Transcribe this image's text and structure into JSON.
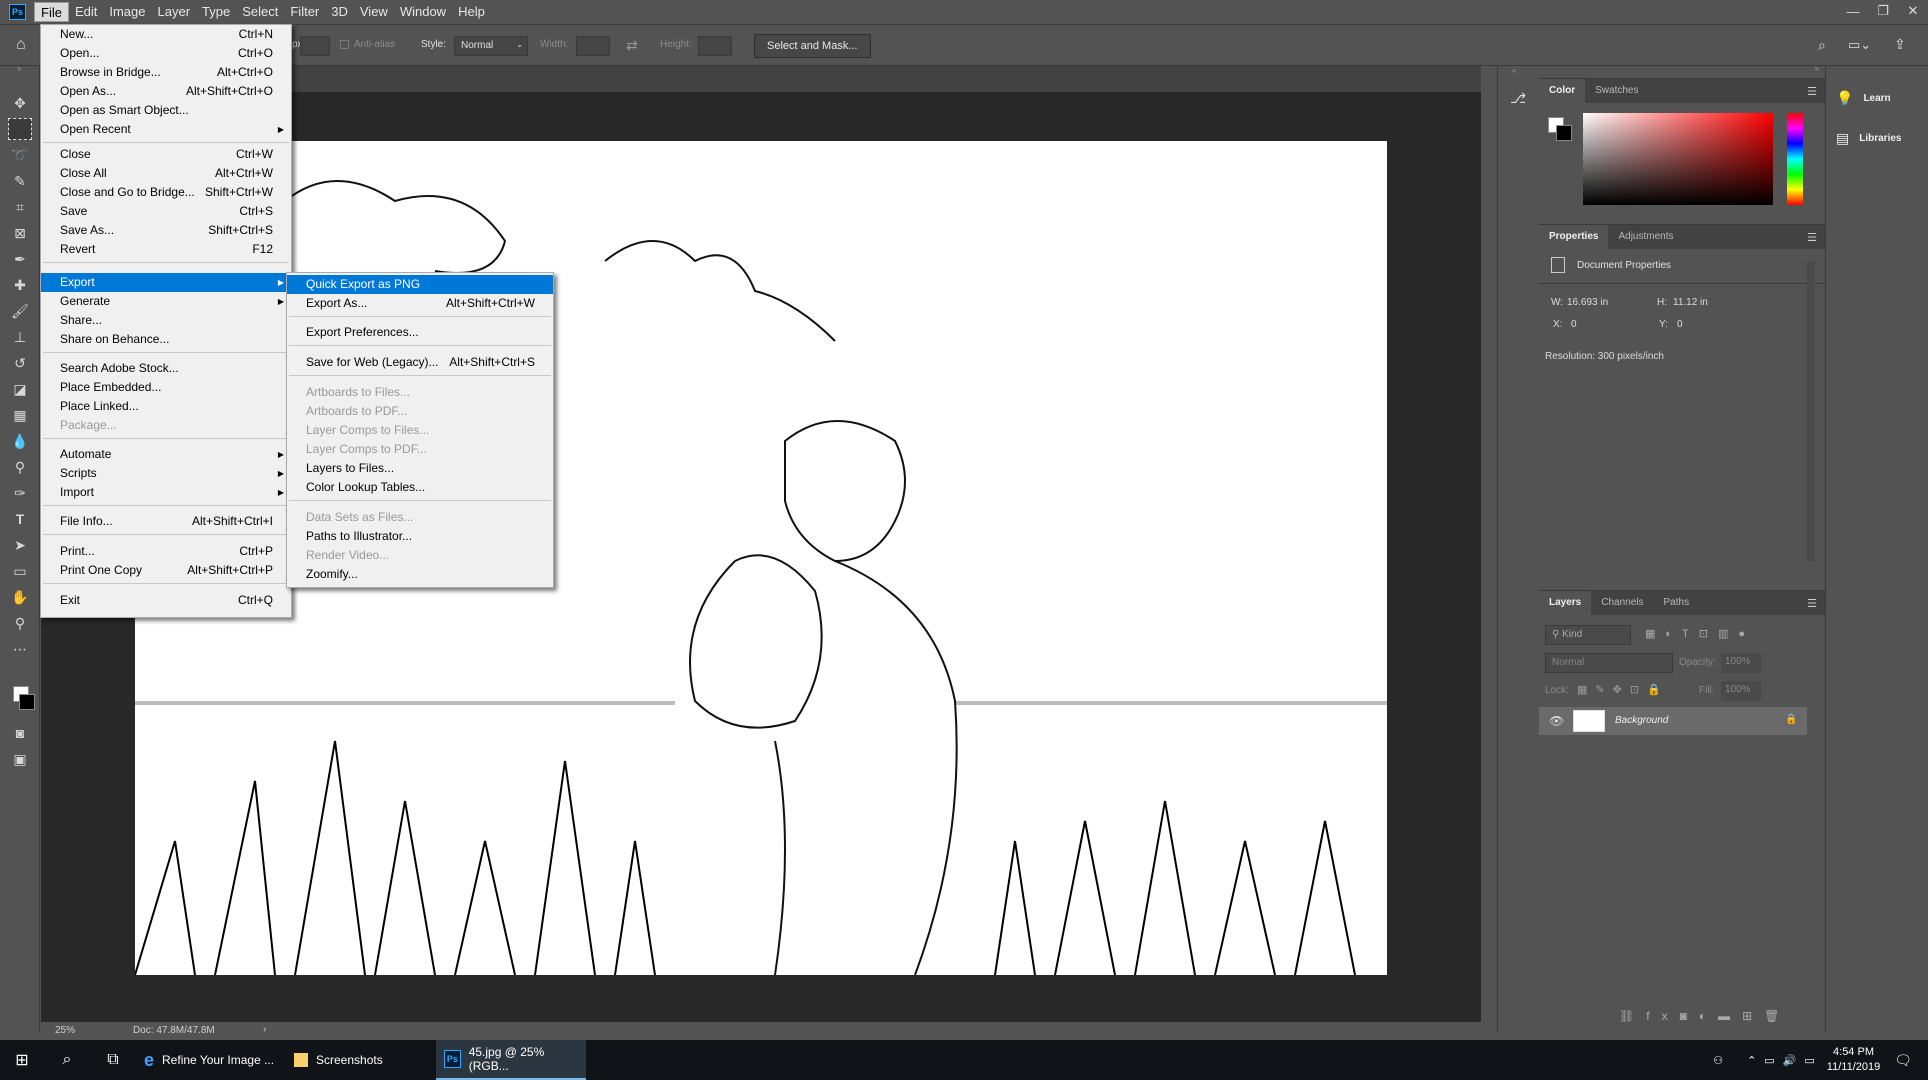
{
  "menubar": {
    "items": [
      "File",
      "Edit",
      "Image",
      "Layer",
      "Type",
      "Select",
      "Filter",
      "3D",
      "View",
      "Window",
      "Help"
    ],
    "logo": "Ps"
  },
  "options": {
    "px_suffix": "px",
    "antialias": "Anti-alias",
    "style_label": "Style:",
    "style_value": "Normal",
    "width_label": "Width:",
    "height_label": "Height:",
    "select_mask": "Select and Mask..."
  },
  "file_menu": {
    "items": [
      {
        "label": "New...",
        "shortcut": "Ctrl+N"
      },
      {
        "label": "Open...",
        "shortcut": "Ctrl+O"
      },
      {
        "label": "Browse in Bridge...",
        "shortcut": "Alt+Ctrl+O"
      },
      {
        "label": "Open As...",
        "shortcut": "Alt+Shift+Ctrl+O"
      },
      {
        "label": "Open as Smart Object...",
        "shortcut": ""
      },
      {
        "label": "Open Recent",
        "shortcut": ""
      },
      {
        "label": "Close",
        "shortcut": "Ctrl+W"
      },
      {
        "label": "Close All",
        "shortcut": "Alt+Ctrl+W"
      },
      {
        "label": "Close and Go to Bridge...",
        "shortcut": "Shift+Ctrl+W"
      },
      {
        "label": "Save",
        "shortcut": "Ctrl+S"
      },
      {
        "label": "Save As...",
        "shortcut": "Shift+Ctrl+S"
      },
      {
        "label": "Revert",
        "shortcut": "F12"
      },
      {
        "label": "Export",
        "shortcut": ""
      },
      {
        "label": "Generate",
        "shortcut": ""
      },
      {
        "label": "Share...",
        "shortcut": ""
      },
      {
        "label": "Share on Behance...",
        "shortcut": ""
      },
      {
        "label": "Search Adobe Stock...",
        "shortcut": ""
      },
      {
        "label": "Place Embedded...",
        "shortcut": ""
      },
      {
        "label": "Place Linked...",
        "shortcut": ""
      },
      {
        "label": "Package...",
        "shortcut": ""
      },
      {
        "label": "Automate",
        "shortcut": ""
      },
      {
        "label": "Scripts",
        "shortcut": ""
      },
      {
        "label": "Import",
        "shortcut": ""
      },
      {
        "label": "File Info...",
        "shortcut": "Alt+Shift+Ctrl+I"
      },
      {
        "label": "Print...",
        "shortcut": "Ctrl+P"
      },
      {
        "label": "Print One Copy",
        "shortcut": "Alt+Shift+Ctrl+P"
      },
      {
        "label": "Exit",
        "shortcut": "Ctrl+Q"
      }
    ]
  },
  "export_menu": {
    "items": [
      {
        "label": "Quick Export as PNG",
        "shortcut": ""
      },
      {
        "label": "Export As...",
        "shortcut": "Alt+Shift+Ctrl+W"
      },
      {
        "label": "Export Preferences...",
        "shortcut": ""
      },
      {
        "label": "Save for Web (Legacy)...",
        "shortcut": "Alt+Shift+Ctrl+S"
      },
      {
        "label": "Artboards to Files...",
        "shortcut": ""
      },
      {
        "label": "Artboards to PDF...",
        "shortcut": ""
      },
      {
        "label": "Layer Comps to Files...",
        "shortcut": ""
      },
      {
        "label": "Layer Comps to PDF...",
        "shortcut": ""
      },
      {
        "label": "Layers to Files...",
        "shortcut": ""
      },
      {
        "label": "Color Lookup Tables...",
        "shortcut": ""
      },
      {
        "label": "Data Sets as Files...",
        "shortcut": ""
      },
      {
        "label": "Paths to Illustrator...",
        "shortcut": ""
      },
      {
        "label": "Render Video...",
        "shortcut": ""
      },
      {
        "label": "Zoomify...",
        "shortcut": ""
      }
    ]
  },
  "color_panel": {
    "tabs": [
      "Color",
      "Swatches"
    ]
  },
  "properties_panel": {
    "tabs": [
      "Properties",
      "Adjustments"
    ],
    "title": "Document Properties",
    "w_label": "W:",
    "w_value": "16.693 in",
    "h_label": "H:",
    "h_value": "11.12 in",
    "x_label": "X:",
    "x_value": "0",
    "y_label": "Y:",
    "y_value": "0",
    "resolution": "Resolution: 300 pixels/inch"
  },
  "layers_panel": {
    "tabs": [
      "Layers",
      "Channels",
      "Paths"
    ],
    "kind": "Kind",
    "blend": "Normal",
    "opacity_label": "Opacity:",
    "opacity_value": "100%",
    "lock_label": "Lock:",
    "fill_label": "Fill:",
    "fill_value": "100%",
    "layer_name": "Background"
  },
  "learn_panel": {
    "learn": "Learn",
    "libraries": "Libraries"
  },
  "status": {
    "zoom": "25%",
    "doc": "Doc: 47.8M/47.8M"
  },
  "taskbar": {
    "apps": [
      "Refine Your Image ...",
      "Screenshots",
      "45.jpg @ 25% (RGB..."
    ],
    "time": "4:54 PM",
    "date": "11/11/2019"
  },
  "colors": {
    "accent": "#0078d7",
    "panel_bg": "#535353",
    "canvas_bg": "#282828"
  }
}
